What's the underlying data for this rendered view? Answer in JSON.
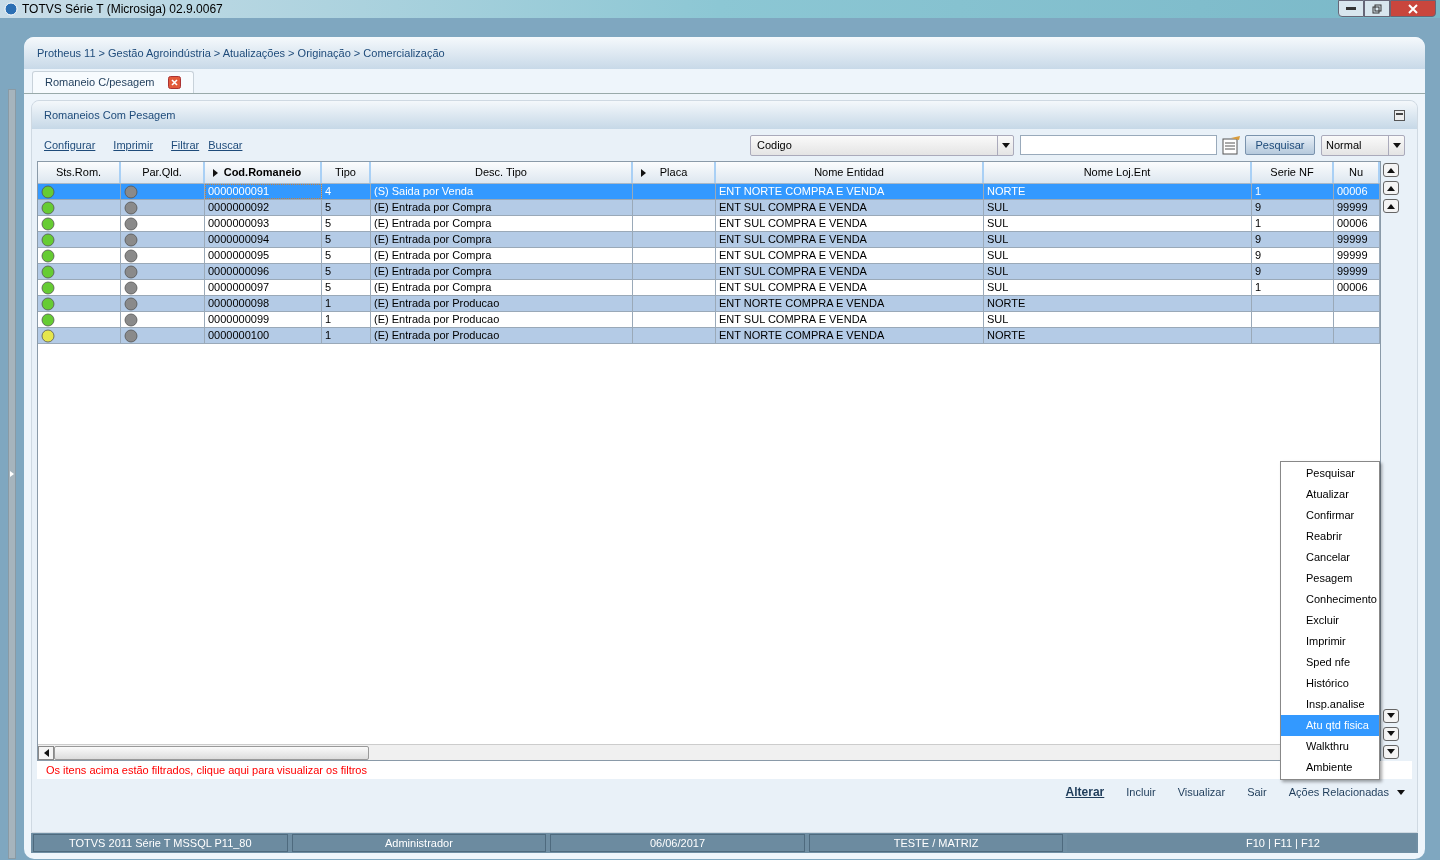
{
  "window": {
    "title": "TOTVS Série T  (Microsiga) 02.9.0067"
  },
  "breadcrumb": "Protheus 11 > Gestão Agroindústria > Atualizações > Originação > Comercialização",
  "tabs": [
    {
      "label": "Romaneio C/pesagem",
      "selected": true
    }
  ],
  "panel": {
    "title": "Romaneios Com Pesagem"
  },
  "toolbar_links": [
    "Configurar",
    "Imprimir",
    "Filtrar",
    "Buscar"
  ],
  "search": {
    "index": "Codigo",
    "button": "Pesquisar",
    "mode": "Normal"
  },
  "table": {
    "columns": [
      {
        "label": "Sts.Rom.",
        "sorted": false,
        "arrow": false
      },
      {
        "label": "Par.Qld.",
        "sorted": false,
        "arrow": false
      },
      {
        "label": "Cod.Romaneio",
        "sorted": true,
        "arrow": true
      },
      {
        "label": "Tipo",
        "sorted": false,
        "arrow": false
      },
      {
        "label": "Desc. Tipo",
        "sorted": false,
        "arrow": false
      },
      {
        "label": "Placa",
        "sorted": false,
        "arrow": true
      },
      {
        "label": "Nome Entidad",
        "sorted": false,
        "arrow": false
      },
      {
        "label": "Nome Loj.Ent",
        "sorted": false,
        "arrow": false
      },
      {
        "label": "Serie NF",
        "sorted": false,
        "arrow": false
      },
      {
        "label": "Nu",
        "sorted": false,
        "arrow": false
      }
    ],
    "rows": [
      {
        "color": "#66cc33",
        "selected": true,
        "cells": [
          "",
          "",
          "0000000091",
          "4",
          "(S) Saida por Venda",
          "",
          "ENT NORTE COMPRA E VENDA",
          "NORTE",
          "1",
          "00006"
        ]
      },
      {
        "color": "#66cc33",
        "selected": false,
        "cells": [
          "",
          "",
          "0000000092",
          "5",
          "(E) Entrada por Compra",
          "",
          "ENT SUL COMPRA E VENDA",
          "SUL",
          "9",
          "99999"
        ]
      },
      {
        "color": "#66cc33",
        "selected": false,
        "cells": [
          "",
          "",
          "0000000093",
          "5",
          "(E) Entrada por Compra",
          "",
          "ENT SUL COMPRA E VENDA",
          "SUL",
          "1",
          "00006"
        ]
      },
      {
        "color": "#66cc33",
        "selected": false,
        "cells": [
          "",
          "",
          "0000000094",
          "5",
          "(E) Entrada por Compra",
          "",
          "ENT SUL COMPRA E VENDA",
          "SUL",
          "9",
          "99999"
        ]
      },
      {
        "color": "#66cc33",
        "selected": false,
        "cells": [
          "",
          "",
          "0000000095",
          "5",
          "(E) Entrada por Compra",
          "",
          "ENT SUL COMPRA E VENDA",
          "SUL",
          "9",
          "99999"
        ]
      },
      {
        "color": "#66cc33",
        "selected": false,
        "cells": [
          "",
          "",
          "0000000096",
          "5",
          "(E) Entrada por Compra",
          "",
          "ENT SUL COMPRA E VENDA",
          "SUL",
          "9",
          "99999"
        ]
      },
      {
        "color": "#66cc33",
        "selected": false,
        "cells": [
          "",
          "",
          "0000000097",
          "5",
          "(E) Entrada por Compra",
          "",
          "ENT SUL COMPRA E VENDA",
          "SUL",
          "1",
          "00006"
        ]
      },
      {
        "color": "#66cc33",
        "selected": false,
        "cells": [
          "",
          "",
          "0000000098",
          "1",
          "(E) Entrada por Producao",
          "",
          "ENT NORTE COMPRA E VENDA",
          "NORTE",
          "",
          ""
        ]
      },
      {
        "color": "#66cc33",
        "selected": false,
        "cells": [
          "",
          "",
          "0000000099",
          "1",
          "(E) Entrada por Producao",
          "",
          "ENT SUL COMPRA E VENDA",
          "SUL",
          "",
          ""
        ]
      },
      {
        "color": "#e6e64d",
        "selected": false,
        "cells": [
          "",
          "",
          "0000000100",
          "1",
          "(E) Entrada por Producao",
          "",
          "ENT NORTE COMPRA E VENDA",
          "NORTE",
          "",
          ""
        ]
      }
    ]
  },
  "filter_note": "Os itens acima estão filtrados, clique aqui para visualizar os filtros",
  "menu": [
    {
      "label": "Pesquisar",
      "selected": false
    },
    {
      "label": "Atualizar",
      "selected": false
    },
    {
      "label": "Confirmar",
      "selected": false
    },
    {
      "label": "Reabrir",
      "selected": false
    },
    {
      "label": "Cancelar",
      "selected": false
    },
    {
      "label": "Pesagem",
      "selected": false
    },
    {
      "label": "Conhecimento",
      "selected": false
    },
    {
      "label": "Excluir",
      "selected": false
    },
    {
      "label": "Imprimir",
      "selected": false
    },
    {
      "label": "Sped nfe",
      "selected": false
    },
    {
      "label": "Histórico",
      "selected": false
    },
    {
      "label": "Insp.analise",
      "selected": false
    },
    {
      "label": "Atu qtd fisica",
      "selected": true
    },
    {
      "label": "Walkthru",
      "selected": false
    },
    {
      "label": "Ambiente",
      "selected": false
    }
  ],
  "actions": [
    {
      "label": "Alterar",
      "primary": true
    },
    {
      "label": "Incluir",
      "primary": false
    },
    {
      "label": "Visualizar",
      "primary": false
    },
    {
      "label": "Sair",
      "primary": false
    }
  ],
  "actions_menu": "Ações Relacionadas",
  "status_bar": [
    "TOTVS 2011 Série T  MSSQL P11_80",
    "Administrador",
    "06/06/2017",
    "TESTE / MATRIZ",
    "F10 | F11 | F12"
  ]
}
